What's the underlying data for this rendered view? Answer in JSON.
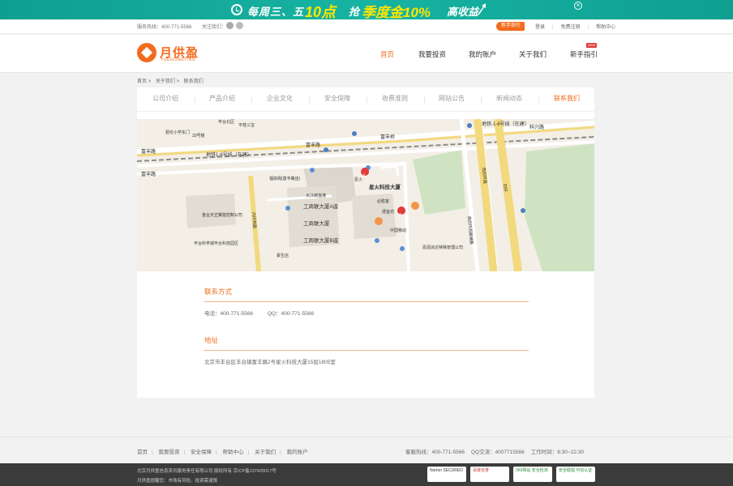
{
  "banner": {
    "schedule": "每周三、五",
    "time": "10点",
    "grab": "抢",
    "product": "季度金10%",
    "yield": "高收益",
    "close_icon": "close-circle-icon"
  },
  "topbar": {
    "hotline_label": "服务热线：",
    "hotline": "400-771-5566",
    "follow_label": "关注我们：",
    "guide_btn": "新手指引",
    "login": "登录",
    "register": "免费注册",
    "help": "帮助中心"
  },
  "header": {
    "logo_text": "月供盈",
    "logo_sub": "YUEGONGYING",
    "nav": [
      "首页",
      "我要投资",
      "我的账户",
      "关于我们",
      "新手指引"
    ],
    "new_badge": "NEW"
  },
  "breadcrumb": [
    "首页 >",
    "关于我们 >",
    "联系我们"
  ],
  "tabs": [
    "公司介绍",
    "产品介绍",
    "企业文化",
    "安全保障",
    "收费准则",
    "网站公告",
    "新闻动态",
    "联系我们"
  ],
  "map": {
    "road_north": "富丰路",
    "road_north2": "富丰桥",
    "metro_north": "地铁1-6号线（在建）",
    "metro_right": "地铁-1-6号线（在建）",
    "road_right": "科兴路",
    "road_left": "富丰路",
    "road_lower_left": "富丰路",
    "pin_a": "星火科技大厦",
    "pin_b_label": "B",
    "b1": "工商联大厦A座",
    "b2": "工商联大厦",
    "b3": "工商联大厦B座",
    "p1": "必胜客",
    "p2": "便宜坊",
    "p3": "中国移动",
    "p4": "大江峡渔港",
    "p5": "福岸阁(富丰路店)",
    "p6": "金台天正聚能控制公司",
    "p7": "丰台科学城丰台科技园区",
    "p8": "恩润派达特殊管理公司",
    "p9": "南四环西路辅路",
    "p10": "西四环路",
    "p11": "四环",
    "p12": "内环西路",
    "p13": "碧伦小学东门",
    "p14": "平桂三宝",
    "p15": "33号楼",
    "p16": "豪生店",
    "p17": "星火",
    "p18": "丰台北区"
  },
  "contact": {
    "title": "联系方式",
    "phone": "电话：400-771-5566",
    "qq": "QQ：400-771-5566",
    "address_title": "地址",
    "address": "北京市丰台区丰台镇富丰路2号星火科技大厦15层1805室"
  },
  "footer_links": {
    "links": [
      "首页",
      "我要投资",
      "安全保障",
      "帮助中心",
      "关于我们",
      "我的账户"
    ],
    "sep": "|",
    "hotline": "客服热线：400-771-5566",
    "qq": "QQ交流：4007715566",
    "hours": "工作时间：8:30~22:30"
  },
  "footer": {
    "copyright": "北京月供盈信息资讯服务责任有限公司  版权所有  京ICP备13742001​7号",
    "risk": "月供盈提醒您：市场有风险，投资需谨慎",
    "badges": [
      "Norton SECURED",
      "百度信誉",
      "360网站 安全检测",
      "安全联盟 可信认证"
    ]
  },
  "colors": {
    "accent": "#f26b1d",
    "banner": "#10a596",
    "footer": "#3b3b3b"
  }
}
